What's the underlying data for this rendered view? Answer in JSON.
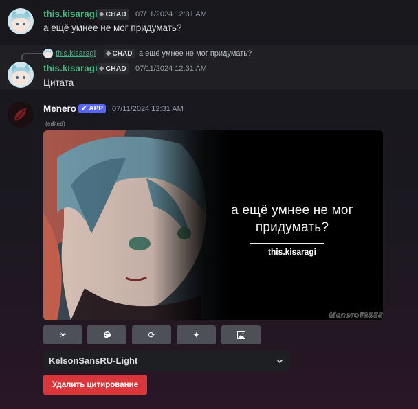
{
  "messages": [
    {
      "username": "this.kisaragi",
      "tag": "CHAD",
      "tag_icon": "diamond-cross-icon",
      "timestamp": "07/11/2024 12:31 AM",
      "content": "а ещё умнее не мог придумать?"
    },
    {
      "reply": {
        "username": "this.kisaragi",
        "tag": "CHAD",
        "text": "а ещё умнее не мог придумать?"
      },
      "username": "this.kisaragi",
      "tag": "CHAD",
      "timestamp": "07/11/2024 12:31 AM",
      "content": "Цитата"
    },
    {
      "username": "Menero",
      "badge": "APP",
      "badge_icon": "checkmark-icon",
      "timestamp": "07/11/2024 12:31 AM",
      "edited": "(edited)",
      "quote_image": {
        "quote": "а ещё умнее не мог придумать?",
        "author": "this.kisaragi",
        "watermark": "Menero#8988"
      },
      "buttons": [
        {
          "icon": "brightness-icon",
          "glyph": "☀"
        },
        {
          "icon": "palette-icon",
          "glyph": "🎨"
        },
        {
          "icon": "refresh-icon",
          "glyph": "⟳"
        },
        {
          "icon": "sparkles-icon",
          "glyph": "✦"
        },
        {
          "icon": "image-icon",
          "glyph": "▣"
        }
      ],
      "font_select": {
        "value": "KelsonSansRU-Light",
        "icon": "chevron-down-icon"
      },
      "delete_button": "Удалить цитирование"
    }
  ],
  "colors": {
    "username": "#43b581",
    "app_badge": "#5865f2",
    "danger": "#da373c"
  }
}
